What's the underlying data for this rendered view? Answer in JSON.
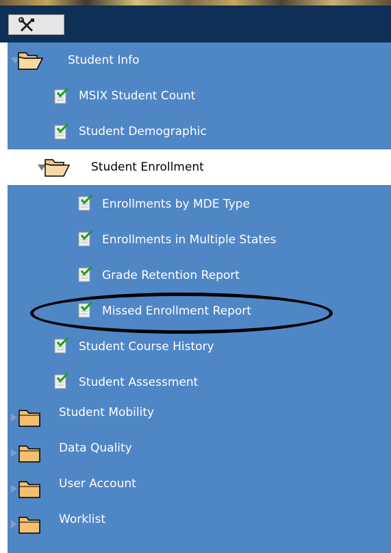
{
  "toolbar": {
    "tools_icon": "tools-icon"
  },
  "tree": {
    "student_info": {
      "label": "Student Info",
      "children": {
        "msix_count": "MSIX Student Count",
        "demographic": "Student Demographic",
        "enrollment": {
          "label": "Student Enrollment",
          "children": {
            "by_mde_type": "Enrollments by MDE Type",
            "multiple_states": "Enrollments in Multiple States",
            "grade_retention": "Grade Retention Report",
            "missed_enrollment": "Missed Enrollment Report"
          }
        },
        "course_history": "Student Course History",
        "assessment": "Student Assessment"
      }
    },
    "student_mobility": "Student Mobility",
    "data_quality": "Data Quality",
    "user_account": "User Account",
    "worklist": "Worklist"
  },
  "colors": {
    "tree_bg": "#4f86c6",
    "toolbar_bg": "#0e2f56",
    "selected_bg": "#ffffff",
    "highlight_ring": "#000000"
  }
}
